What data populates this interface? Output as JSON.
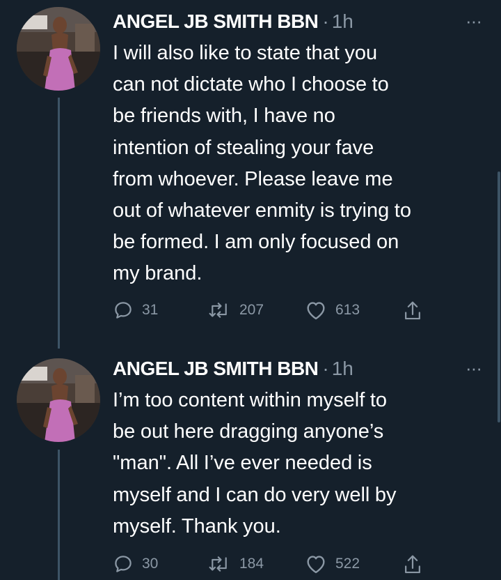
{
  "tweets": [
    {
      "author": "ANGEL JB SMITH BBN",
      "separator": "·",
      "time": "1h",
      "more": "···",
      "text": "I will also like to state that you\ncan not dictate who I choose to\nbe friends with, I have no\nintention of stealing your fave\nfrom whoever. Please leave me\nout of whatever enmity is trying to\nbe formed. I am only focused on\nmy brand.",
      "replies": "31",
      "retweets": "207",
      "likes": "613"
    },
    {
      "author": "ANGEL JB SMITH BBN",
      "separator": "·",
      "time": "1h",
      "more": "···",
      "text": "I’m too content within myself to\nbe out here dragging anyone’s\n\"man\". All I’ve ever needed is\nmyself and I can do very well by\nmyself. Thank you.",
      "replies": "30",
      "retweets": "184",
      "likes": "522"
    }
  ],
  "icons": {
    "reply": "reply-icon",
    "retweet": "retweet-icon",
    "like": "heart-icon",
    "share": "share-icon",
    "more": "more-icon"
  },
  "colors": {
    "background": "#15202b",
    "secondary_text": "#8b98a5",
    "thread_line": "#3d5466"
  }
}
